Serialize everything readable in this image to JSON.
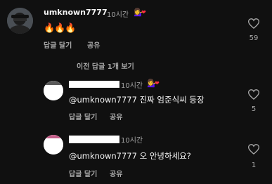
{
  "comments": [
    {
      "username": "umknown7777",
      "time": "10시간",
      "creator_badge": "woman-tipping-hand-icon",
      "like_badge": "red-heart-icon",
      "text": "🔥🔥🔥",
      "reply_label": "답글 달기",
      "share_label": "공유",
      "like_count": "59",
      "heart_icon": "heart-outline-icon"
    }
  ],
  "view_previous_replies": "이전 답글 1개 보기",
  "replies": [
    {
      "time": "10시간",
      "creator_badge": "woman-tipping-hand-icon",
      "like_badge": "red-heart-icon",
      "text": "@umknown7777 진짜 엄준식씨 등장",
      "reply_label": "답글 달기",
      "share_label": "공유",
      "like_count": "5",
      "heart_icon": "heart-outline-icon"
    },
    {
      "time": "10시간",
      "text": "@umknown7777 오 안녕하세요?",
      "reply_label": "답글 달기",
      "share_label": "공유",
      "like_count": "1",
      "heart_icon": "heart-outline-icon"
    }
  ],
  "colors": {
    "background": "#101010",
    "text": "#f5f5f5",
    "muted": "#a8a8a8",
    "heart_badge": "#ff3040"
  }
}
